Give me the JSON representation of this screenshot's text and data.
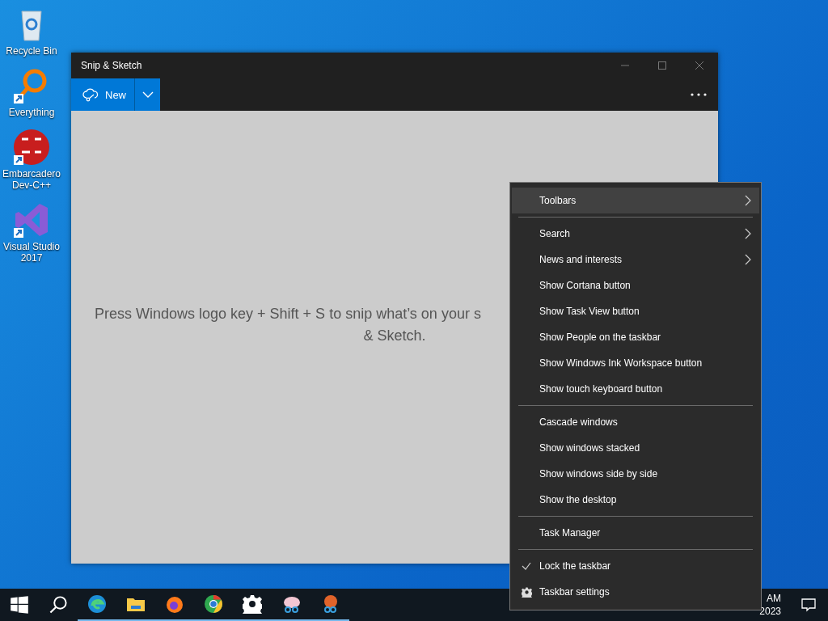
{
  "desktop_icons": [
    {
      "label": "Recycle Bin",
      "kind": "bin",
      "shortcut": false
    },
    {
      "label": "Everything",
      "kind": "magnifier",
      "shortcut": true
    },
    {
      "label": "Embarcadero Dev-C++",
      "kind": "devcpp",
      "shortcut": true
    },
    {
      "label": "Visual Studio 2017",
      "kind": "vs",
      "shortcut": true
    }
  ],
  "window": {
    "title": "Snip & Sketch",
    "new_button": "New",
    "message_lines": [
      "Press Windows logo key + Shift + S to snip what’s on your s",
      "& Sketch."
    ]
  },
  "context_menu": {
    "groups": [
      [
        {
          "label": "Toolbars",
          "kind": "submenu",
          "selected": true
        }
      ],
      [
        {
          "label": "Search",
          "kind": "submenu",
          "selected": false
        },
        {
          "label": "News and interests",
          "kind": "submenu",
          "selected": false
        },
        {
          "label": "Show Cortana button",
          "kind": "plain",
          "selected": false
        },
        {
          "label": "Show Task View button",
          "kind": "plain",
          "selected": false
        },
        {
          "label": "Show People on the taskbar",
          "kind": "plain",
          "selected": false
        },
        {
          "label": "Show Windows Ink Workspace button",
          "kind": "plain",
          "selected": false
        },
        {
          "label": "Show touch keyboard button",
          "kind": "plain",
          "selected": false
        }
      ],
      [
        {
          "label": "Cascade windows",
          "kind": "plain",
          "selected": false
        },
        {
          "label": "Show windows stacked",
          "kind": "plain",
          "selected": false
        },
        {
          "label": "Show windows side by side",
          "kind": "plain",
          "selected": false
        },
        {
          "label": "Show the desktop",
          "kind": "plain",
          "selected": false
        }
      ],
      [
        {
          "label": "Task Manager",
          "kind": "plain",
          "selected": false
        }
      ],
      [
        {
          "label": "Lock the taskbar",
          "kind": "check",
          "checked": true,
          "selected": false
        },
        {
          "label": "Taskbar settings",
          "kind": "settings",
          "selected": false
        }
      ]
    ]
  },
  "taskbar": {
    "clock_time": "AM",
    "clock_date": "2023"
  }
}
